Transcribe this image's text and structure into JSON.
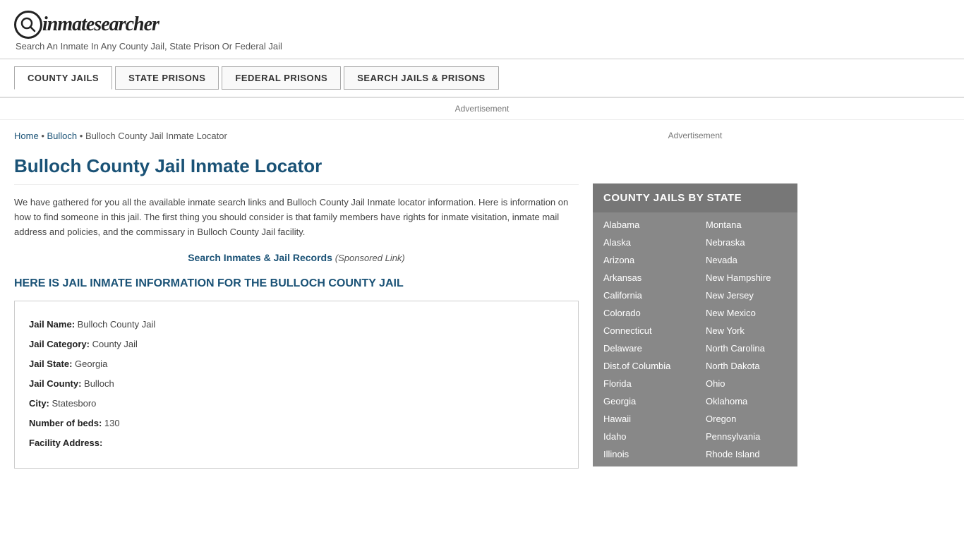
{
  "header": {
    "logo_icon": "🔍",
    "logo_text_prefix": "inmate",
    "logo_text_suffix": "searcher",
    "tagline": "Search An Inmate In Any County Jail, State Prison Or Federal Jail"
  },
  "nav": {
    "items": [
      {
        "label": "COUNTY JAILS",
        "active": true
      },
      {
        "label": "STATE PRISONS",
        "active": false
      },
      {
        "label": "FEDERAL PRISONS",
        "active": false
      },
      {
        "label": "SEARCH JAILS & PRISONS",
        "active": false
      }
    ]
  },
  "ad_label": "Advertisement",
  "breadcrumb": {
    "home": "Home",
    "separator1": "•",
    "middle": "Bulloch",
    "separator2": "•",
    "current": "Bulloch County Jail Inmate Locator"
  },
  "page_title": "Bulloch County Jail Inmate Locator",
  "description": "We have gathered for you all the available inmate search links and Bulloch County Jail Inmate locator information. Here is information on how to find someone in this jail. The first thing you should consider is that family members have rights for inmate visitation, inmate mail address and policies, and the commissary in Bulloch County Jail facility.",
  "sponsored": {
    "link_text": "Search Inmates & Jail Records",
    "suffix": "(Sponsored Link)"
  },
  "section_heading": "HERE IS JAIL INMATE INFORMATION FOR THE BULLOCH COUNTY JAIL",
  "jail_info": {
    "name_label": "Jail Name:",
    "name_value": "Bulloch County Jail",
    "category_label": "Jail Category:",
    "category_value": "County Jail",
    "state_label": "Jail State:",
    "state_value": "Georgia",
    "county_label": "Jail County:",
    "county_value": "Bulloch",
    "city_label": "City:",
    "city_value": "Statesboro",
    "beds_label": "Number of beds:",
    "beds_value": "130",
    "address_label": "Facility Address:"
  },
  "sidebar": {
    "ad_label": "Advertisement",
    "box_title": "COUNTY JAILS BY STATE",
    "states_left": [
      "Alabama",
      "Alaska",
      "Arizona",
      "Arkansas",
      "California",
      "Colorado",
      "Connecticut",
      "Delaware",
      "Dist.of Columbia",
      "Florida",
      "Georgia",
      "Hawaii",
      "Idaho",
      "Illinois"
    ],
    "states_right": [
      "Montana",
      "Nebraska",
      "Nevada",
      "New Hampshire",
      "New Jersey",
      "New Mexico",
      "New York",
      "North Carolina",
      "North Dakota",
      "Ohio",
      "Oklahoma",
      "Oregon",
      "Pennsylvania",
      "Rhode Island"
    ]
  }
}
